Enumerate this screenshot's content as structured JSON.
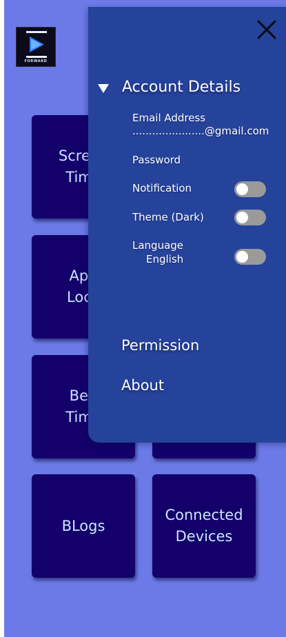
{
  "logo": {
    "text": "FORWARD"
  },
  "tiles": [
    {
      "label": "Screen\nTime"
    },
    {
      "label": "App\nLock"
    },
    {
      "label": "Bed\nTime"
    },
    {
      "label": ""
    },
    {
      "label": "BLogs"
    },
    {
      "label": "Connected\nDevices"
    }
  ],
  "drawer": {
    "close_icon": "close-icon",
    "account": {
      "title": "Account Details",
      "email_label": "Email Address",
      "email_value": "......................@gmail.com",
      "password_label": "Password",
      "notification_label": "Notification",
      "notification_on": false,
      "theme_label": "Theme (Dark)",
      "theme_on": false,
      "language_label": "Language",
      "language_value": "English",
      "language_on": false
    },
    "permission_label": "Permission",
    "about_label": "About"
  },
  "colors": {
    "background": "#6b7ae6",
    "tile": "#13006b",
    "drawer": "#25439a",
    "toggle_off": "#9a9a9a"
  }
}
